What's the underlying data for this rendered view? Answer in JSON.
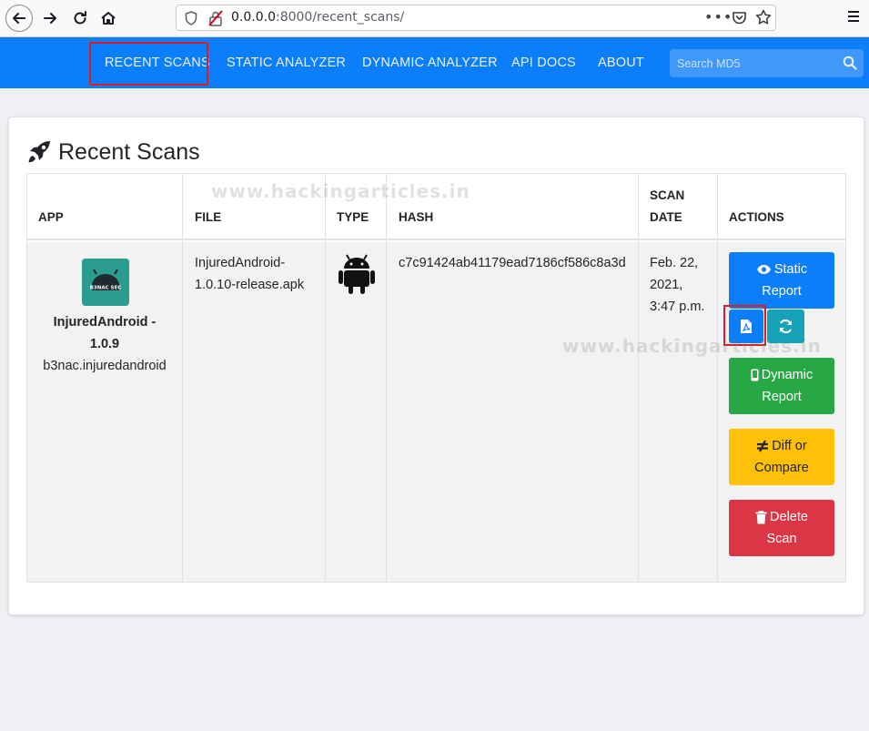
{
  "browser": {
    "url_host": "0.0.0.0",
    "url_path": ":8000/recent_scans/",
    "page_actions_glyph": "•••"
  },
  "navbar": {
    "items": [
      {
        "label": "RECENT SCANS"
      },
      {
        "label": "STATIC ANALYZER"
      },
      {
        "label": "DYNAMIC ANALYZER"
      },
      {
        "label": "API DOCS"
      },
      {
        "label": "ABOUT"
      }
    ],
    "active_index": 0,
    "search_placeholder": "Search MD5",
    "color": "#0d7ef9"
  },
  "page": {
    "title": "Recent Scans",
    "title_icon": "rocket-icon"
  },
  "table": {
    "headers": {
      "app": "APP",
      "file": "FILE",
      "type": "TYPE",
      "hash": "HASH",
      "scan_date_1": "SCAN",
      "scan_date_2": "DATE",
      "actions": "ACTIONS"
    },
    "rows": [
      {
        "app_icon_text": "B3NAC SEC",
        "app_name_1": "InjuredAndroid -",
        "app_name_2": "1.0.9",
        "app_package": "b3nac.injuredandroid",
        "file_1": "InjuredAndroid-",
        "file_2": "1.0.10-release.apk",
        "type_icon": "android-icon",
        "hash": "c7c91424ab41179ead7186cf586c8a3d",
        "date_1": "Feb. 22,",
        "date_2": "2021,",
        "date_3": "3:47 p.m.",
        "actions": {
          "static_1": "Static",
          "static_2": "Report",
          "dynamic_1": "Dynamic",
          "dynamic_2": "Report",
          "diff_1": "Diff or",
          "diff_2": "Compare",
          "delete_1": "Delete",
          "delete_2": "Scan"
        }
      }
    ]
  },
  "watermark": "www.hackingarticles.in",
  "colors": {
    "blue": "#0d7ef9",
    "teal": "#17a2b8",
    "green": "#28a745",
    "yellow": "#ffc107",
    "red": "#dc3545",
    "highlight": "#e01b24"
  }
}
